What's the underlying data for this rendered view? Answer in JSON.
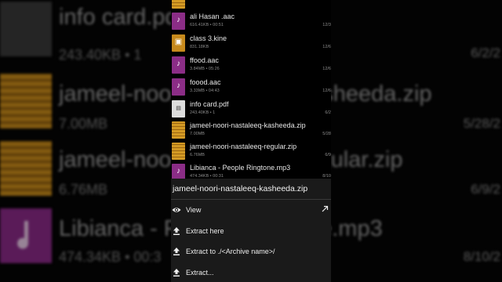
{
  "background": {
    "rows": [
      {
        "name": "info card.pdf",
        "meta": "243.40KB • 1",
        "date": "6/2/2",
        "icon": "pdf-icon"
      },
      {
        "name": "jameel-noori-nastaleeq-kasheeda.zip",
        "meta": "7.00MB",
        "date": "5/28/2",
        "icon": "zip-icon"
      },
      {
        "name": "jameel-noori-nastaleeq-regular.zip",
        "meta": "6.76MB",
        "date": "6/9/2",
        "icon": "zip-icon"
      },
      {
        "name": "Libianca - People Ringtone.mp3",
        "meta": "474.34KB • 00:3",
        "date": "8/10/2",
        "icon": "music-icon"
      }
    ]
  },
  "files": [
    {
      "name": "",
      "meta": "",
      "date": "",
      "type": "zip"
    },
    {
      "name": "ali Hasan .aac",
      "meta": "616.41KB • 00:51",
      "date": "12/3",
      "type": "audio"
    },
    {
      "name": "class 3.kine",
      "meta": "831.18KB",
      "date": "12/6",
      "type": "kine"
    },
    {
      "name": "ffood.aac",
      "meta": "3.84MB • 05:26",
      "date": "12/6",
      "type": "audio"
    },
    {
      "name": "foood.aac",
      "meta": "3.33MB • 04:43",
      "date": "12/6",
      "type": "audio"
    },
    {
      "name": "info card.pdf",
      "meta": "243.40KB • 1",
      "date": "6/2",
      "type": "pdf"
    },
    {
      "name": "jameel-noori-nastaleeq-kasheeda.zip",
      "meta": "7.00MB",
      "date": "5/28",
      "type": "zip"
    },
    {
      "name": "jameel-noori-nastaleeq-regular.zip",
      "meta": "6.76MB",
      "date": "6/9",
      "type": "zip"
    },
    {
      "name": "Libianca - People Ringtone.mp3",
      "meta": "474.34KB • 00:31",
      "date": "8/10",
      "type": "audio"
    }
  ],
  "sheet": {
    "title": "jameel-noori-nastaleeq-kasheeda.zip",
    "items": [
      {
        "label": "View",
        "icon": "eye-icon"
      },
      {
        "label": "Extract here",
        "icon": "upload-icon"
      },
      {
        "label": "Extract to ./<Archive name>/",
        "icon": "upload-icon"
      },
      {
        "label": "Extract...",
        "icon": "upload-icon"
      }
    ]
  },
  "colors": {
    "audio": "#8b2d86",
    "zip": "#d39a24",
    "sheet_bg": "#1a1a1a"
  }
}
